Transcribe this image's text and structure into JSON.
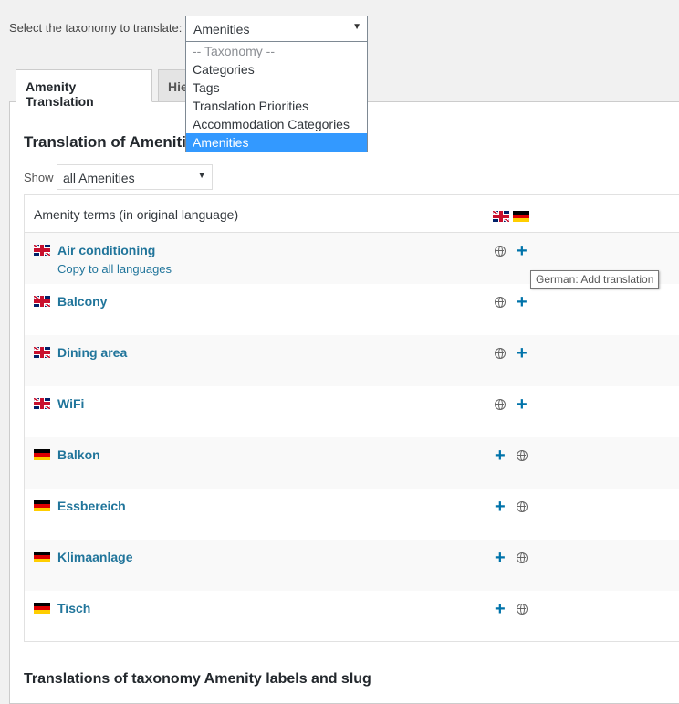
{
  "taxonomy_select": {
    "label": "Select the taxonomy to translate:",
    "selected": "Amenities",
    "options": [
      "-- Taxonomy --",
      "Categories",
      "Tags",
      "Translation Priorities",
      "Accommodation Categories",
      "Amenities"
    ]
  },
  "tabs": [
    {
      "label": "Amenity Translation",
      "active": true
    },
    {
      "label": "Hie",
      "active": false
    }
  ],
  "section_title": "Translation of Amenities",
  "filter": {
    "label": "Show",
    "selected": "all Amenities"
  },
  "table": {
    "header": "Amenity terms (in original language)",
    "header_flags": [
      "uk-flag",
      "de-flag"
    ],
    "rows": [
      {
        "lang": "en",
        "term": "Air conditioning",
        "copy_link": "Copy to all languages",
        "icons": [
          "globe",
          "plus"
        ]
      },
      {
        "lang": "en",
        "term": "Balcony",
        "icons": [
          "globe",
          "plus"
        ]
      },
      {
        "lang": "en",
        "term": "Dining area",
        "icons": [
          "globe",
          "plus"
        ]
      },
      {
        "lang": "en",
        "term": "WiFi",
        "icons": [
          "globe",
          "plus"
        ]
      },
      {
        "lang": "de",
        "term": "Balkon",
        "icons": [
          "plus",
          "globe"
        ]
      },
      {
        "lang": "de",
        "term": "Essbereich",
        "icons": [
          "plus",
          "globe"
        ]
      },
      {
        "lang": "de",
        "term": "Klimaanlage",
        "icons": [
          "plus",
          "globe"
        ]
      },
      {
        "lang": "de",
        "term": "Tisch",
        "icons": [
          "plus",
          "globe"
        ]
      }
    ]
  },
  "tooltip": "German: Add translation",
  "bottom_title": "Translations of taxonomy Amenity labels and slug",
  "colors": {
    "link": "#21759b",
    "accent": "#0073aa",
    "selected_option": "#3399ff"
  }
}
